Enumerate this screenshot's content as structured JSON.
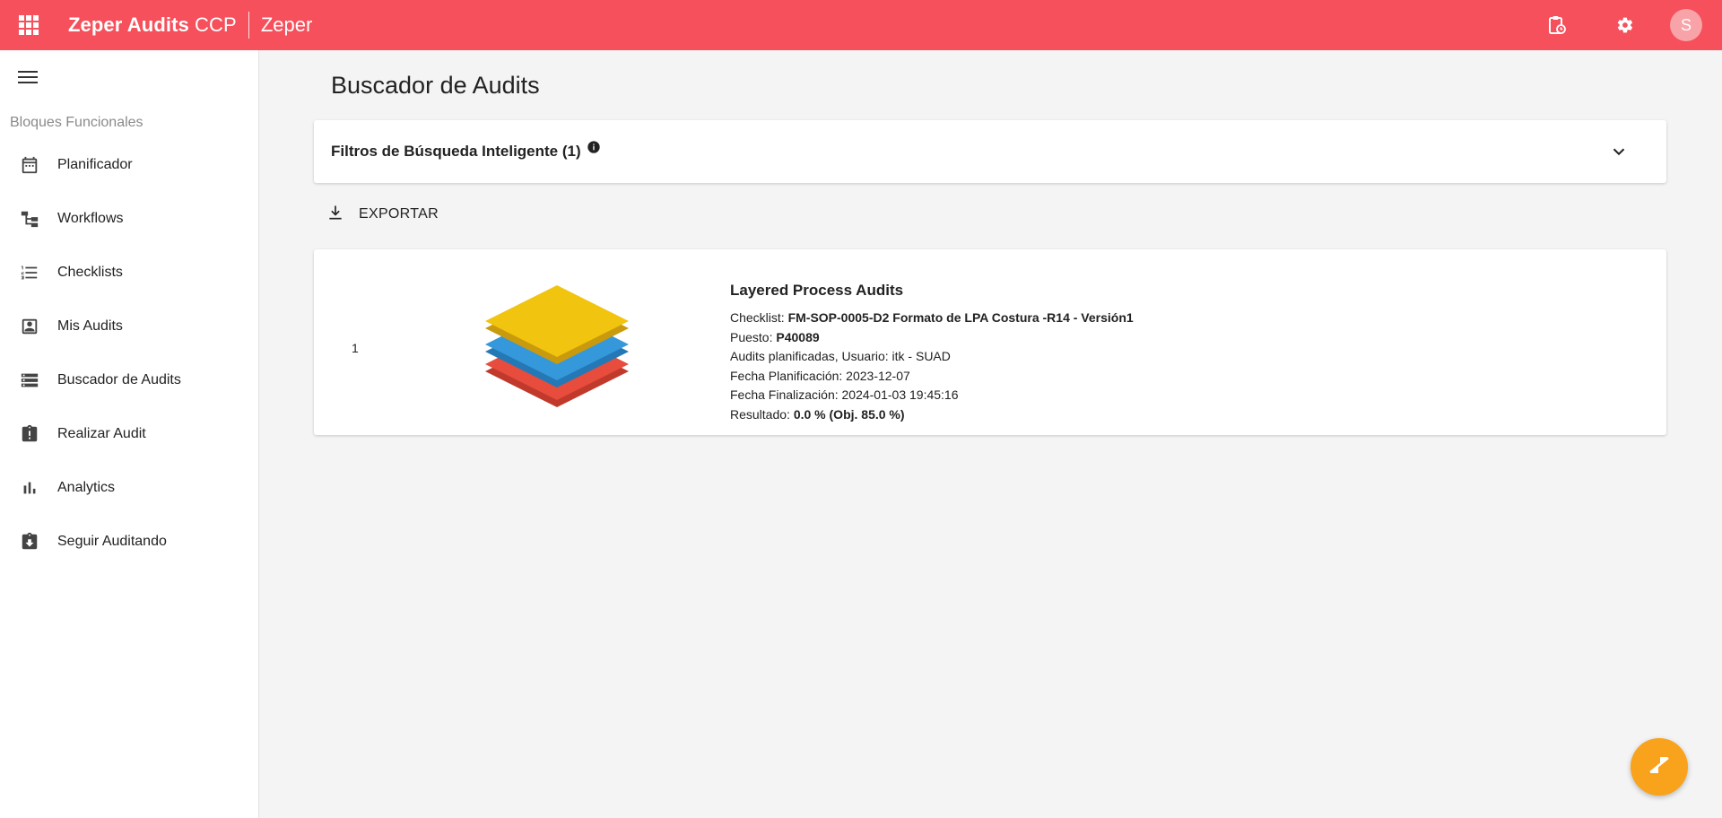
{
  "header": {
    "app_name_bold": "Zeper Audits",
    "app_name_suffix": " CCP",
    "org_name": "Zeper",
    "avatar_initial": "S",
    "colors": {
      "bar": "#f5505b",
      "avatar": "#f8a3a8"
    },
    "icons": [
      "apps-grid-icon",
      "clipboard-clock-icon",
      "gear-icon"
    ]
  },
  "sidebar": {
    "section_label": "Bloques Funcionales",
    "items": [
      {
        "label": "Planificador",
        "icon": "calendar-icon"
      },
      {
        "label": "Workflows",
        "icon": "workflow-icon"
      },
      {
        "label": "Checklists",
        "icon": "list-numbered-icon"
      },
      {
        "label": "Mis Audits",
        "icon": "account-box-icon"
      },
      {
        "label": "Buscador de Audits",
        "icon": "storage-icon"
      },
      {
        "label": "Realizar Audit",
        "icon": "assignment-alert-icon"
      },
      {
        "label": "Analytics",
        "icon": "bar-chart-icon"
      },
      {
        "label": "Seguir Auditando",
        "icon": "assignment-download-icon"
      }
    ]
  },
  "main": {
    "title": "Buscador de Audits",
    "filters_label": "Filtros de Búsqueda Inteligente (1)",
    "export_label": "EXPORTAR",
    "results": [
      {
        "index": "1",
        "title": "Layered Process Audits",
        "checklist_label": "Checklist: ",
        "checklist_value": "FM-SOP-0005-D2 Formato de LPA Costura -R14 - Versión1",
        "puesto_label": "Puesto: ",
        "puesto_value": "P40089",
        "audits_line": "Audits planificadas, Usuario: itk - SUAD",
        "fecha_plan": "Fecha Planificación: 2023-12-07",
        "fecha_fin": "Fecha Finalización: 2024-01-03 19:45:16",
        "resultado_label": "Resultado: ",
        "resultado_value": "0.0 % (Obj. 85.0 %)",
        "layer_colors": [
          "#f1c40f",
          "#3498db",
          "#e74c3c"
        ]
      }
    ]
  },
  "fab": {
    "icon": "zendesk-icon",
    "color": "#f9a21b"
  }
}
